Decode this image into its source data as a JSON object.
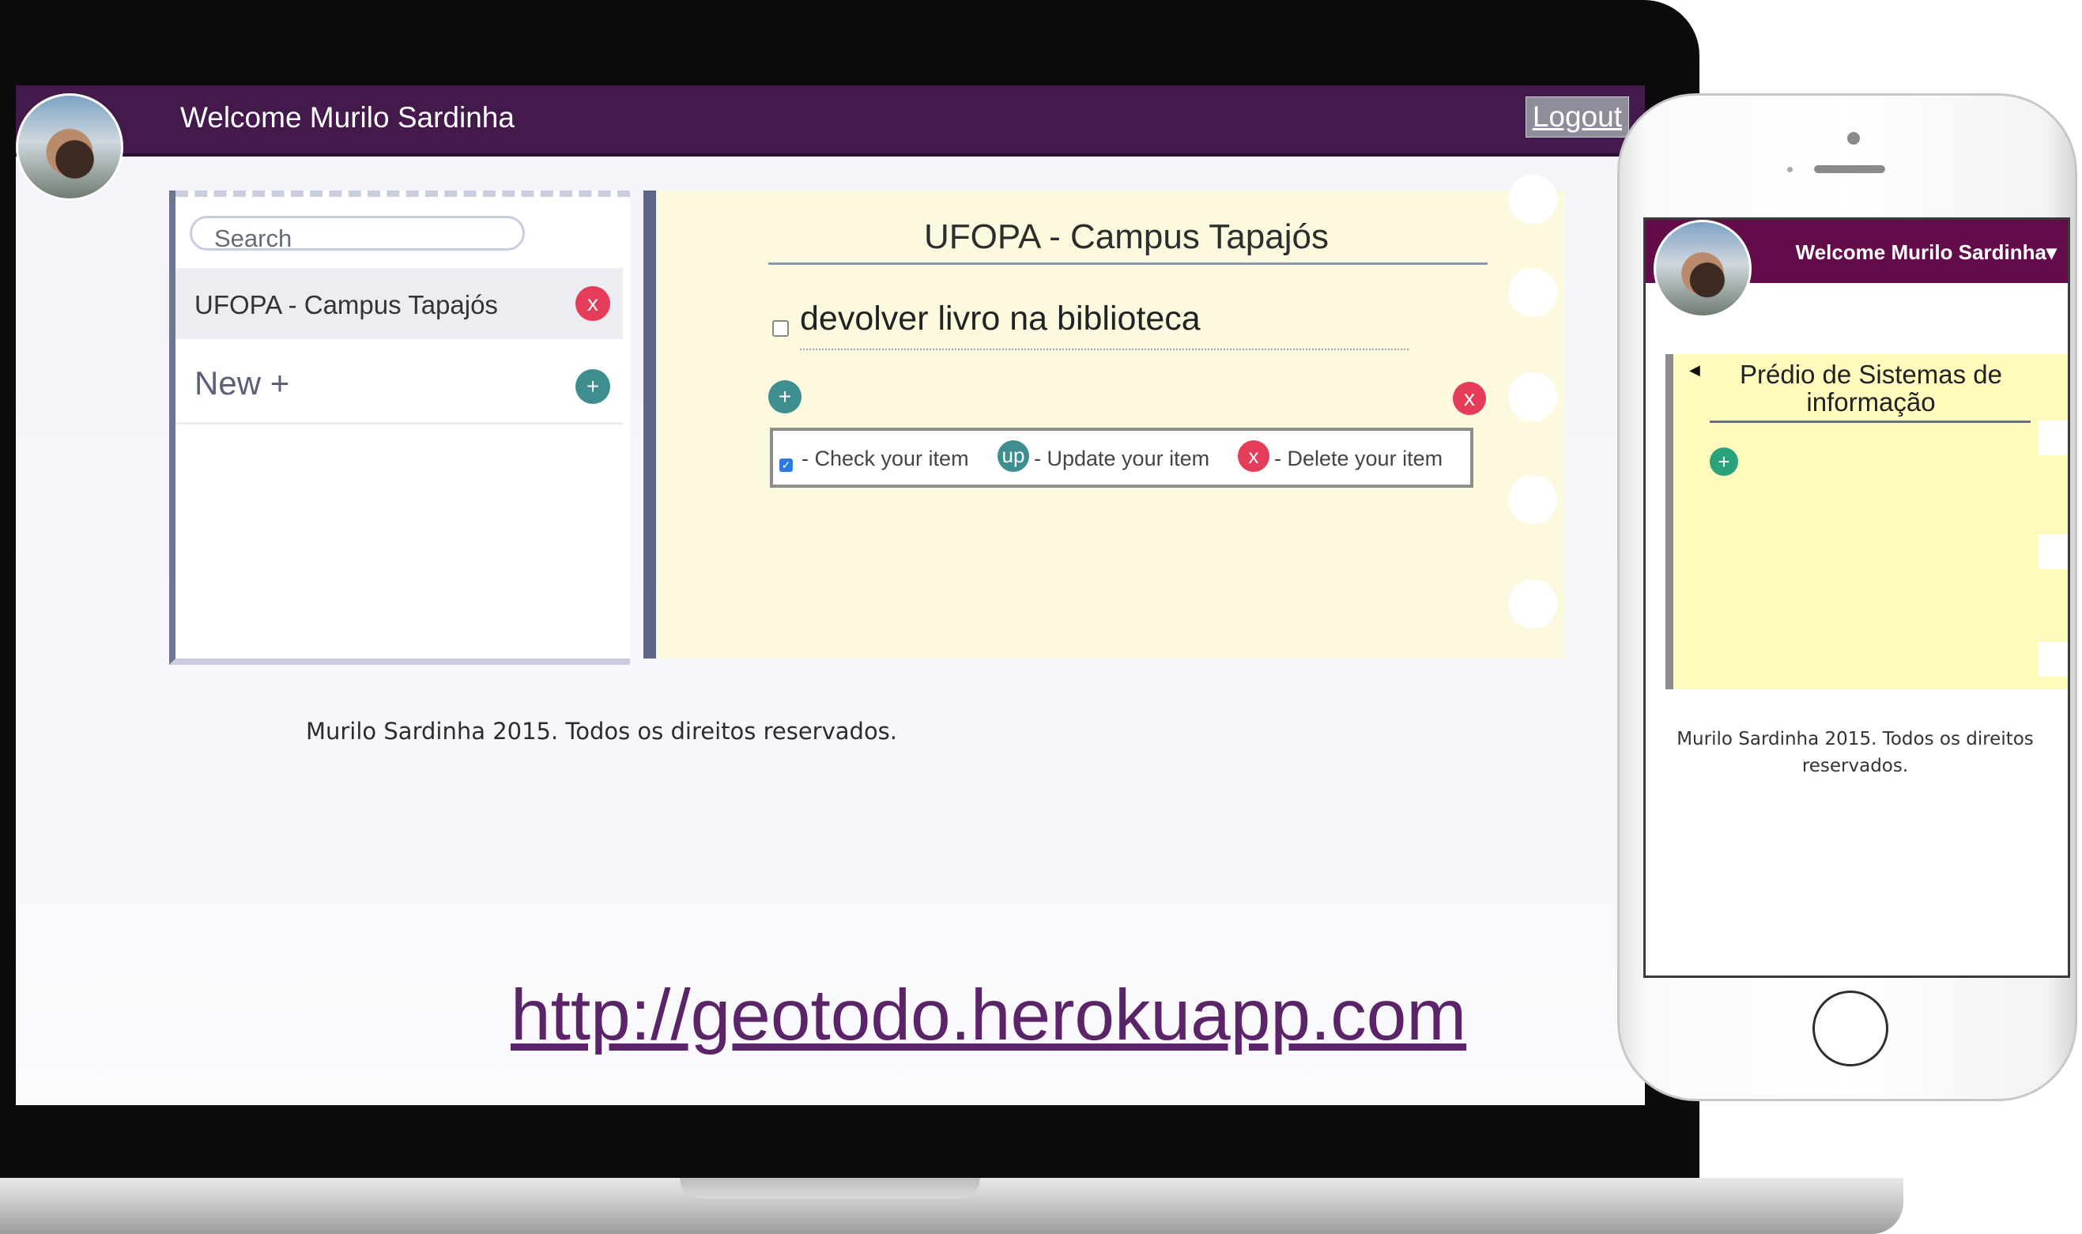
{
  "desktop": {
    "header": {
      "welcome_text": "Welcome Murilo Sardinha",
      "logout_label": "Logout"
    },
    "sidebar": {
      "search_placeholder": "Search",
      "items": [
        {
          "label": "UFOPA - Campus Tapajós",
          "delete_icon": "x"
        }
      ],
      "new_label": "New +",
      "new_icon": "+"
    },
    "notes": {
      "title": "UFOPA - Campus Tapajós",
      "todos": [
        {
          "text": "devolver livro na biblioteca",
          "checked": false
        }
      ],
      "add_icon": "+",
      "delete_icon": "x",
      "legend": {
        "check_label": "- Check your item",
        "update_badge": "up",
        "update_label": "- Update your item",
        "delete_badge": "x",
        "delete_label": "- Delete your item"
      }
    },
    "footer": "Murilo Sardinha 2015. Todos os direitos reservados."
  },
  "url_text": "http://geotodo.herokuapp.com",
  "mobile": {
    "welcome_text": "Welcome Murilo Sardinha▾",
    "notes_title": "Prédio de Sistemas de informação",
    "add_icon": "+",
    "footer": "Murilo Sardinha 2015. Todos os direitos reservados."
  },
  "colors": {
    "header_purple": "#441a4c",
    "mobile_header": "#640c4a",
    "notes_bg": "#fdf9df",
    "mobile_notes_bg": "#fefbbd",
    "delete_red": "#e53c5a",
    "add_teal": "#3f8e8f",
    "url_purple": "#5b2468"
  }
}
